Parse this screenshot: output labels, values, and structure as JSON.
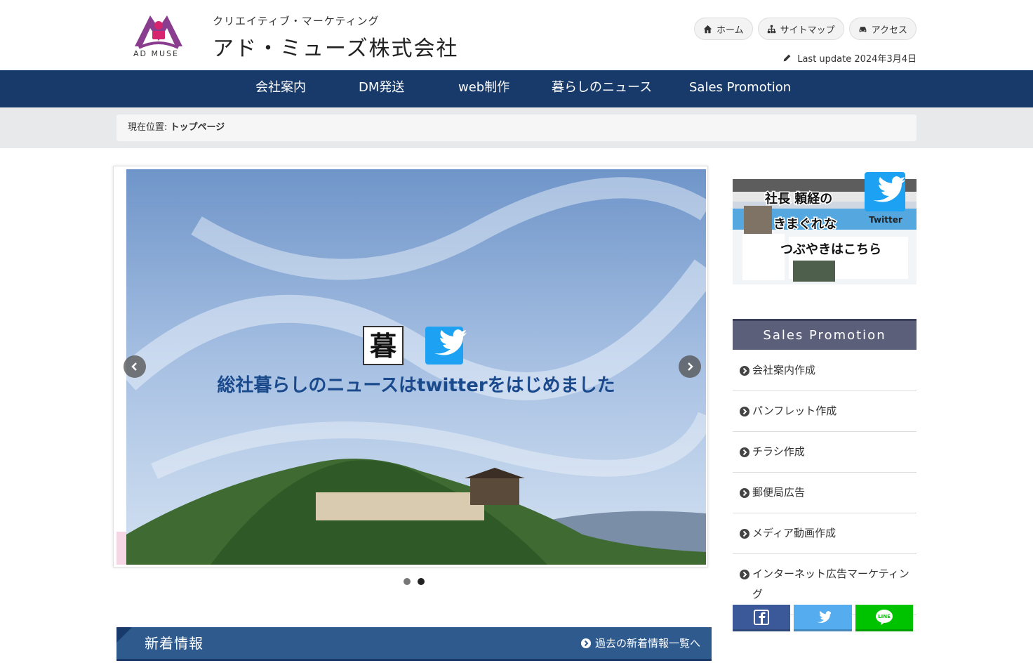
{
  "header": {
    "logo_text": "AD MUSE",
    "tagline": "クリエイティブ・マーケティング",
    "company_name": "アド・ミューズ株式会社",
    "top_links": [
      {
        "label": "ホーム",
        "icon": "home-icon"
      },
      {
        "label": "サイトマップ",
        "icon": "sitemap-icon"
      },
      {
        "label": "アクセス",
        "icon": "car-icon"
      }
    ],
    "last_update_label": "Last update 2024年3月4日"
  },
  "nav": {
    "items": [
      "会社案内",
      "DM発送",
      "web制作",
      "暮らしのニュース",
      "Sales Promotion"
    ],
    "bg_color": "#173a6a"
  },
  "breadcrumb": {
    "prefix": "現在位置:",
    "current": "トップページ"
  },
  "slider": {
    "caption": "総社暮らしのニュースはtwitterをはじめました",
    "badge_char": "暮",
    "active_dot": 2,
    "dot_count": 2
  },
  "news": {
    "title": "新着情報",
    "more_label": "過去の新着情報一覧へ"
  },
  "twitter_banner": {
    "line1": "社長 頼経の",
    "line2": "きまぐれな",
    "line3": "つぶやきはこちら",
    "service": "Twitter"
  },
  "sales_promotion": {
    "title": "Sales Promotion",
    "items": [
      "会社案内作成",
      "パンフレット作成",
      "チラシ作成",
      "郵便局広告",
      "メディア動画作成",
      "インターネット広告マーケティング"
    ]
  },
  "social": {
    "facebook_color": "#3b5998",
    "twitter_color": "#55acee",
    "line_color": "#00c300",
    "line_label": "LINE"
  }
}
